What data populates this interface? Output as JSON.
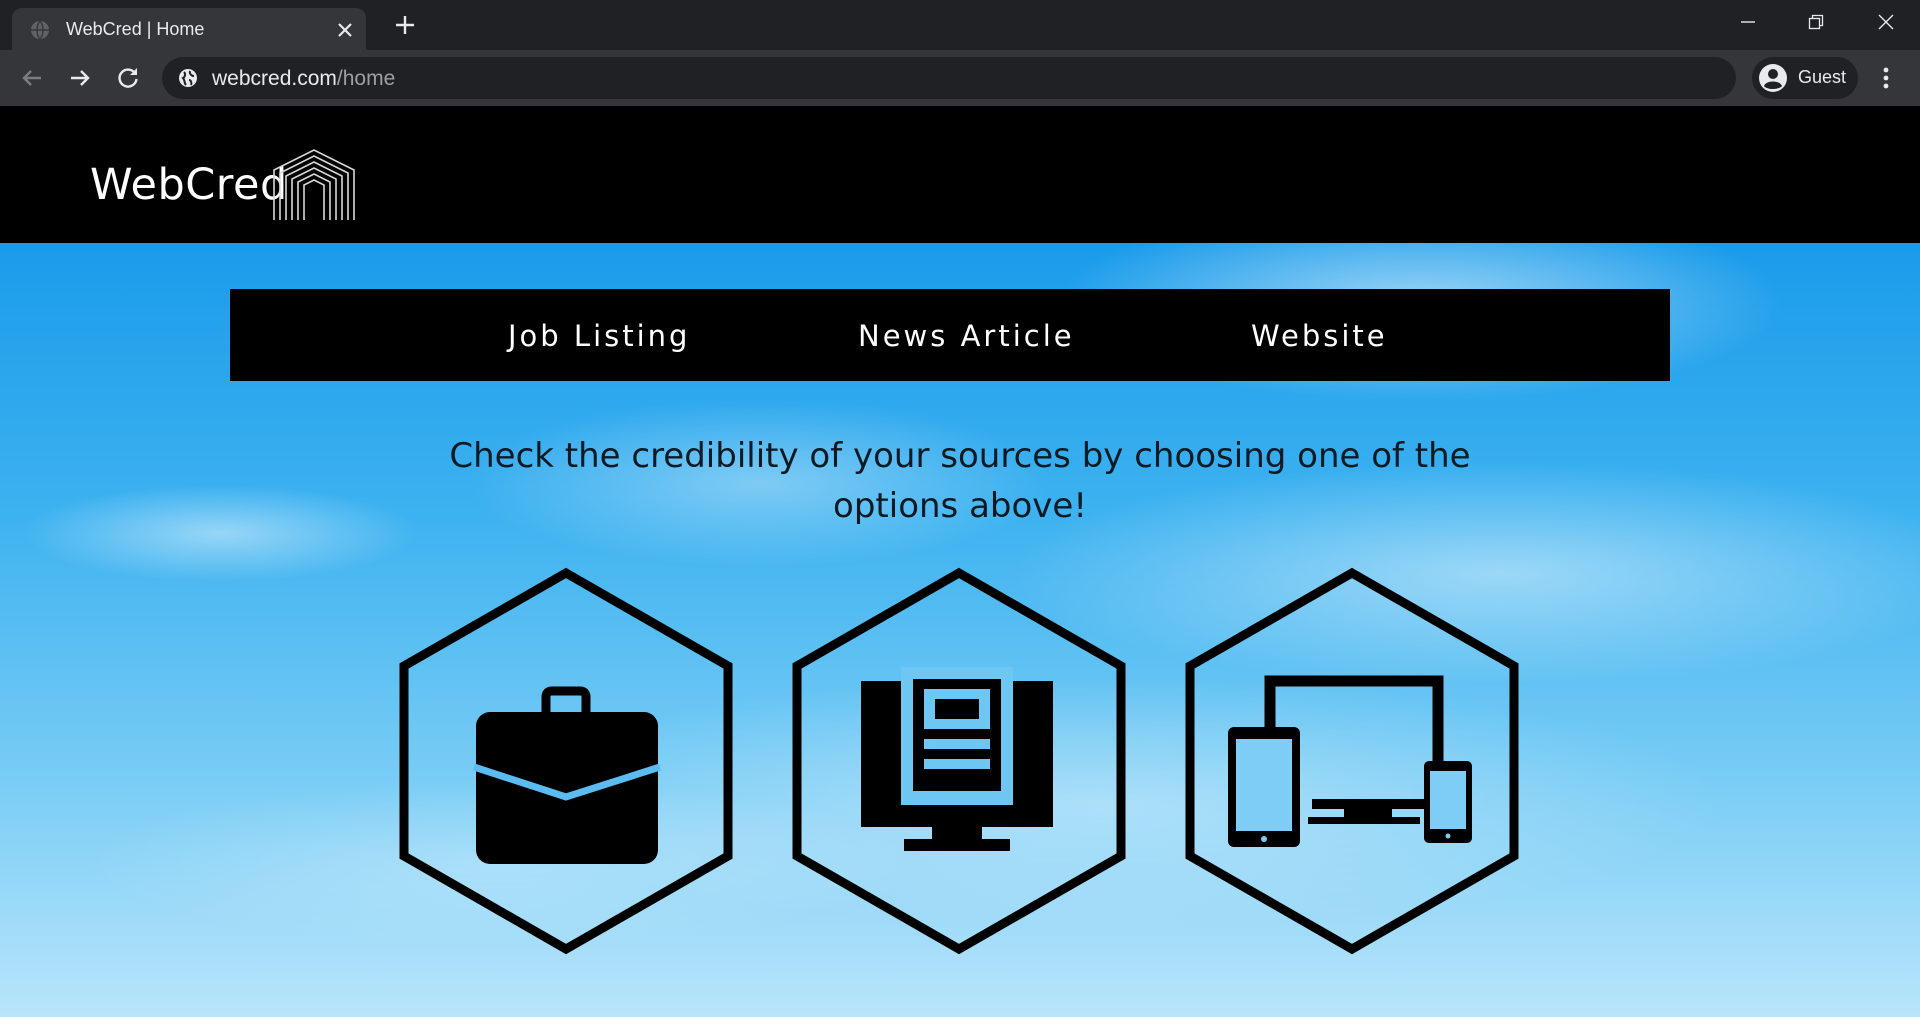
{
  "browser": {
    "tab": {
      "title": "WebCred | Home"
    },
    "address_bar": {
      "host": "webcred.com",
      "path": "/home"
    },
    "profile": {
      "label": "Guest"
    }
  },
  "site": {
    "logo_text": "WebCred",
    "nav_options": [
      {
        "label": "Job Listing",
        "icon": "briefcase-icon"
      },
      {
        "label": "News Article",
        "icon": "news-monitor-icon"
      },
      {
        "label": "Website",
        "icon": "multi-device-icon"
      }
    ],
    "tagline": "Check the credibility of your sources by choosing one of the options above!"
  },
  "colors": {
    "chrome_dark": "#202124",
    "chrome_toolbar": "#35363a",
    "header_bg": "#000000",
    "sky_top": "#1a9bea",
    "sky_bottom": "#b9e5fb"
  }
}
